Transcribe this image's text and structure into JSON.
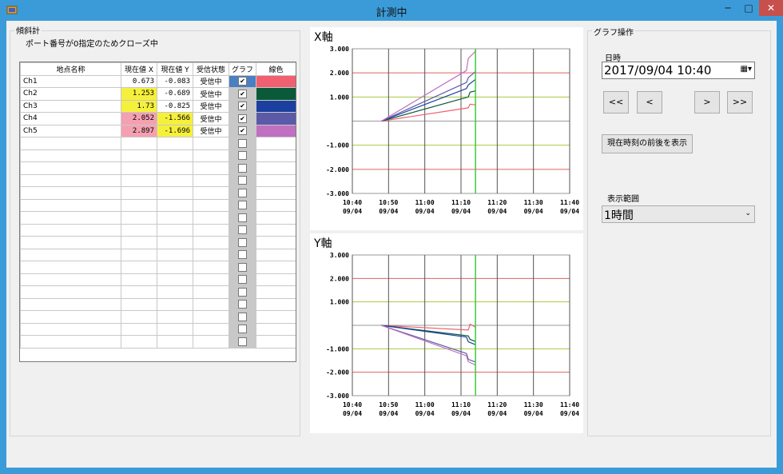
{
  "window": {
    "title": "計測中",
    "min_glyph": "─",
    "max_glyph": "□",
    "close_glyph": "✕"
  },
  "left_panel": {
    "group_title": "傾斜計",
    "port_message": "ポート番号が0指定のためクローズ中",
    "columns": [
      "地点名称",
      "現在値 X",
      "現在値 Y",
      "受信状態",
      "グラフ",
      "線色"
    ],
    "rows": [
      {
        "name": "Ch1",
        "x": "0.673",
        "y": "-0.083",
        "status": "受信中",
        "graph": true,
        "x_bg": "#ffffff",
        "y_bg": "#ffffff",
        "color": "#f06070",
        "check_bg": "#4a7fc1"
      },
      {
        "name": "Ch2",
        "x": "1.253",
        "y": "-0.689",
        "status": "受信中",
        "graph": true,
        "x_bg": "#f5f03c",
        "y_bg": "#ffffff",
        "color": "#0a5a3a",
        "check_bg": "#c8c8c8"
      },
      {
        "name": "Ch3",
        "x": "1.73",
        "y": "-0.825",
        "status": "受信中",
        "graph": true,
        "x_bg": "#f5f03c",
        "y_bg": "#ffffff",
        "color": "#1c3fa0",
        "check_bg": "#c8c8c8"
      },
      {
        "name": "Ch4",
        "x": "2.052",
        "y": "-1.566",
        "status": "受信中",
        "graph": true,
        "x_bg": "#f4a0b0",
        "y_bg": "#f5f03c",
        "color": "#5a5aa8",
        "check_bg": "#c8c8c8"
      },
      {
        "name": "Ch5",
        "x": "2.897",
        "y": "-1.696",
        "status": "受信中",
        "graph": true,
        "x_bg": "#f4a0b0",
        "y_bg": "#f5f03c",
        "color": "#c070c0",
        "check_bg": "#c8c8c8"
      }
    ],
    "empty_rows": 17
  },
  "chart_data": [
    {
      "type": "line",
      "title": "X軸",
      "ylim": [
        -3.0,
        3.0
      ],
      "yticks": [
        "3.000",
        "2.000",
        "1.000",
        "",
        "-1.000",
        "-2.000",
        "-3.000"
      ],
      "xticks": [
        [
          "10:40",
          "09/04"
        ],
        [
          "10:50",
          "09/04"
        ],
        [
          "11:00",
          "09/04"
        ],
        [
          "11:10",
          "09/04"
        ],
        [
          "11:20",
          "09/04"
        ],
        [
          "11:30",
          "09/04"
        ],
        [
          "11:40",
          "09/04"
        ]
      ],
      "xlim_minutes_from_first_tick": [
        0,
        60
      ],
      "marker_minute": 34,
      "grid": true,
      "series": [
        {
          "color": "#f06070",
          "points": [
            [
              8,
              0
            ],
            [
              32,
              0.55
            ],
            [
              32.5,
              0.7
            ],
            [
              34,
              0.673
            ]
          ]
        },
        {
          "color": "#0a5a3a",
          "points": [
            [
              8,
              0
            ],
            [
              32,
              1.0
            ],
            [
              32.5,
              1.2
            ],
            [
              34,
              1.253
            ]
          ]
        },
        {
          "color": "#1c3fa0",
          "points": [
            [
              8,
              0
            ],
            [
              31.5,
              1.35
            ],
            [
              32,
              1.5
            ],
            [
              34,
              1.73
            ]
          ]
        },
        {
          "color": "#5a5aa8",
          "points": [
            [
              8,
              0
            ],
            [
              31.5,
              1.6
            ],
            [
              32,
              1.8
            ],
            [
              34,
              2.052
            ]
          ]
        },
        {
          "color": "#c070c0",
          "points": [
            [
              8,
              0
            ],
            [
              31.5,
              2.1
            ],
            [
              32,
              2.6
            ],
            [
              34,
              2.897
            ]
          ]
        }
      ]
    },
    {
      "type": "line",
      "title": "Y軸",
      "ylim": [
        -3.0,
        3.0
      ],
      "yticks": [
        "3.000",
        "2.000",
        "1.000",
        "",
        "-1.000",
        "-2.000",
        "-3.000"
      ],
      "xticks": [
        [
          "10:40",
          "09/04"
        ],
        [
          "10:50",
          "09/04"
        ],
        [
          "11:00",
          "09/04"
        ],
        [
          "11:10",
          "09/04"
        ],
        [
          "11:20",
          "09/04"
        ],
        [
          "11:30",
          "09/04"
        ],
        [
          "11:40",
          "09/04"
        ]
      ],
      "xlim_minutes_from_first_tick": [
        0,
        60
      ],
      "marker_minute": 34,
      "grid": true,
      "series": [
        {
          "color": "#f06070",
          "points": [
            [
              8,
              0
            ],
            [
              32,
              -0.2
            ],
            [
              32.5,
              0.05
            ],
            [
              34,
              -0.083
            ]
          ]
        },
        {
          "color": "#0a5a3a",
          "points": [
            [
              8,
              0
            ],
            [
              32,
              -0.45
            ],
            [
              32.5,
              -0.6
            ],
            [
              34,
              -0.689
            ]
          ]
        },
        {
          "color": "#1c3fa0",
          "points": [
            [
              8,
              0
            ],
            [
              31.5,
              -0.5
            ],
            [
              32,
              -0.7
            ],
            [
              34,
              -0.825
            ]
          ]
        },
        {
          "color": "#5a5aa8",
          "points": [
            [
              8,
              0
            ],
            [
              31.5,
              -1.2
            ],
            [
              32,
              -1.45
            ],
            [
              34,
              -1.566
            ]
          ]
        },
        {
          "color": "#c070c0",
          "points": [
            [
              8,
              0
            ],
            [
              31.5,
              -1.3
            ],
            [
              32,
              -1.55
            ],
            [
              34,
              -1.696
            ]
          ]
        }
      ]
    }
  ],
  "right_panel": {
    "group_title": "グラフ操作",
    "date_label": "日時",
    "date_value": "2017/09/04  10:40",
    "btn_first": "<<",
    "btn_prev": "<",
    "btn_next": ">",
    "btn_last": ">>",
    "btn_around_now": "現在時刻の前後を表示",
    "range_label": "表示範囲",
    "range_value": "1時間"
  },
  "colors": {
    "title_bar": "#3b9bd8",
    "close_button": "#c7504c",
    "grid_gray": "#9a9a9a",
    "grid_red": "#e06060",
    "grid_green": "#a8c840",
    "marker_green": "#3ccb3c"
  }
}
